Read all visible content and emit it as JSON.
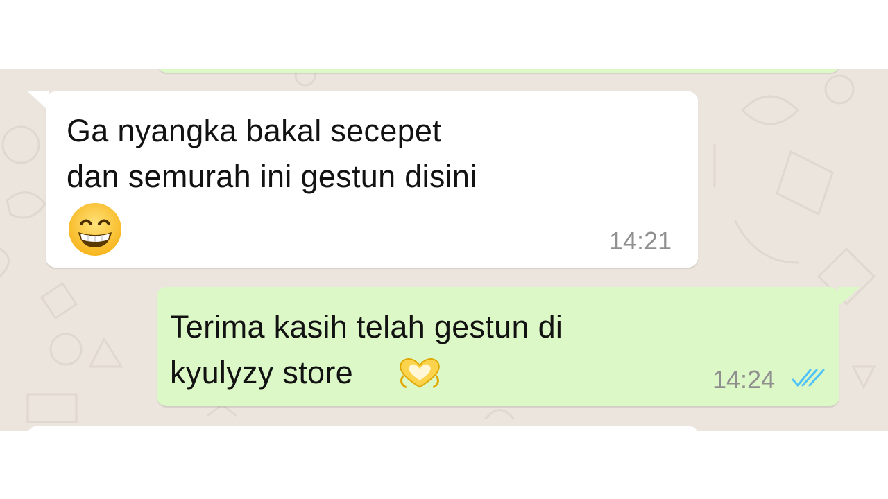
{
  "messages": [
    {
      "direction": "incoming",
      "line1": "Ga nyangka bakal secepet",
      "line2": "dan semurah ini gestun disini",
      "emoji": "grinning-face-with-smiling-eyes",
      "time": "14:21"
    },
    {
      "direction": "outgoing",
      "line1": "Terima kasih telah gestun di",
      "line2": "kyulyzy store",
      "emoji": "heart-hands",
      "time": "14:24",
      "status": "read"
    }
  ],
  "colors": {
    "chat_background": "#ece5dd",
    "incoming_bubble": "#ffffff",
    "outgoing_bubble": "#dcf8c6",
    "timestamp": "#8f8f8f",
    "read_ticks": "#4fc3f7"
  }
}
